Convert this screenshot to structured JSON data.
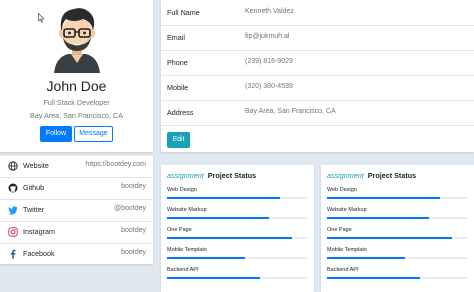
{
  "profile": {
    "name": "John Doe",
    "title": "Full Stack Developer",
    "location": "Bay Area, San Francisco, CA",
    "follow_label": "Follow",
    "message_label": "Message"
  },
  "social": [
    {
      "icon": "globe-icon",
      "label": "Website",
      "value": "https://bootdey.com",
      "color": "#212529"
    },
    {
      "icon": "github-icon",
      "label": "Github",
      "value": "bootdey",
      "color": "#212529"
    },
    {
      "icon": "twitter-icon",
      "label": "Twitter",
      "value": "@bootdey",
      "color": "#1da1f2"
    },
    {
      "icon": "instagram-icon",
      "label": "Instagram",
      "value": "bootdey",
      "color": "#e1306c"
    },
    {
      "icon": "facebook-icon",
      "label": "Facebook",
      "value": "bootdey",
      "color": "#3b5998"
    }
  ],
  "details": {
    "rows": [
      {
        "label": "Full Name",
        "value": "Kenneth Valdez"
      },
      {
        "label": "Email",
        "value": "fip@jukmuh.al"
      },
      {
        "label": "Phone",
        "value": "(239) 816-9029"
      },
      {
        "label": "Mobile",
        "value": "(320) 380-4539"
      },
      {
        "label": "Address",
        "value": "Bay Area, San Francisco, CA"
      }
    ],
    "edit_label": "Edit"
  },
  "projects": [
    {
      "assign_label": "assignment",
      "title": "Project Status",
      "items": [
        {
          "label": "Web Design",
          "progress": 0.8
        },
        {
          "label": "Website Markup",
          "progress": 0.72
        },
        {
          "label": "One Page",
          "progress": 0.89
        },
        {
          "label": "Mobile Template",
          "progress": 0.55
        },
        {
          "label": "Backend API",
          "progress": 0.66
        }
      ]
    },
    {
      "assign_label": "assignment",
      "title": "Project Status",
      "items": [
        {
          "label": "Web Design",
          "progress": 0.8
        },
        {
          "label": "Website Markup",
          "progress": 0.72
        },
        {
          "label": "One Page",
          "progress": 0.89
        },
        {
          "label": "Mobile Template",
          "progress": 0.55
        },
        {
          "label": "Backend API",
          "progress": 0.66
        }
      ]
    }
  ],
  "colors": {
    "primary": "#007bff",
    "info": "#17a2b8",
    "background": "#e2e8f0"
  }
}
